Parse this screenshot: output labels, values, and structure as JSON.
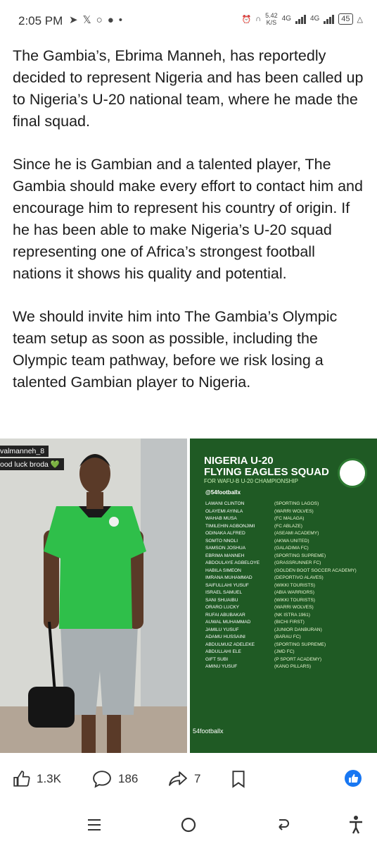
{
  "status": {
    "time": "2:05 PM",
    "speed_value": "5.42",
    "speed_unit": "K/S",
    "network_1": "4G",
    "network_2": "4G",
    "battery": "45"
  },
  "article": {
    "paragraphs": [
      "The Gambia’s, Ebrima Manneh, has reportedly decided to represent Nigeria and has been called up to Nigeria’s U-20 national team, where he made the final squad.",
      "Since he is Gambian and a talented player, The Gambia should make every effort to contact him and encourage him to represent his country of origin. If he has been able to make Nigeria’s U-20 squad representing one of Africa’s strongest football nations it shows his quality and potential.",
      "We should invite him into The Gambia’s Olympic team setup as soon as possible, including the Olympic team pathway, before we risk losing a talented Gambian player to Nigeria."
    ]
  },
  "left_image": {
    "username": "valmanneh_8",
    "caption": "ood luck broda 💚"
  },
  "right_image": {
    "title_line1": "NIGERIA U-20",
    "title_line2": "FLYING EAGLES SQUAD",
    "subtitle": "FOR WAFU-B U-20 CHAMPIONSHIP",
    "watermark_top": "@54footballx",
    "watermark_bottom": "54footballx",
    "roster": [
      {
        "player": "LAWANI CLINTON",
        "club": "(SPORTING LAGOS)"
      },
      {
        "player": "OLAYEMI AYINLA",
        "club": "(WARRI WOLVES)"
      },
      {
        "player": "WAHAB MUSA",
        "club": "(FC MALAGA)"
      },
      {
        "player": "TIMILEHIN AGBONJIMI",
        "club": "(FC ABLAZE)"
      },
      {
        "player": "ODINAKA ALFRED",
        "club": "(ASEAMI ACADEMY)"
      },
      {
        "player": "SOMTO NNOLI",
        "club": "(AKWA UNITED)"
      },
      {
        "player": "SAMSON JOSHUA",
        "club": "(GALADIMA FC)"
      },
      {
        "player": "EBRIMA MANNEH",
        "club": "(SPORTING SUPREME)"
      },
      {
        "player": "ABDOULAYE AGBELOYE",
        "club": "(GRASSRUNNER FC)"
      },
      {
        "player": "HABILA SIMEON",
        "club": "(GOLDEN BOOT SOCCER ACADEMY)"
      },
      {
        "player": "IMRANA MUHAMMAD",
        "club": "(DEPORTIVO ALAVES)"
      },
      {
        "player": "SAIFULLAHI YUSUF",
        "club": "(WIKKI TOURISTS)"
      },
      {
        "player": "ISRAEL SAMUEL",
        "club": "(ABIA WARRIORS)"
      },
      {
        "player": "SANI SHUAIBU",
        "club": "(WIKKI TOURISTS)"
      },
      {
        "player": "ORARO LUCKY",
        "club": "(WARRI WOLVES)"
      },
      {
        "player": "RUFAI ABUBAKAR",
        "club": "(NK ISTRA 1961)"
      },
      {
        "player": "AUWAL MUHAMMAD",
        "club": "(BICHI FIRST)"
      },
      {
        "player": "JAMILU YUSUF",
        "club": "(JUNIOR DANBURAN)"
      },
      {
        "player": "ADAMU HUSSAINI",
        "club": "(BARAU FC)"
      },
      {
        "player": "ABDULMUIZ ADELEKE",
        "club": "(SPORTING SUPREME)"
      },
      {
        "player": "ABDULLAHI ELE",
        "club": "(JMD FC)"
      },
      {
        "player": "GIFT SUBI",
        "club": "(P SPORT ACADEMY)"
      },
      {
        "player": "AMINU YUSUF",
        "club": "(KANO PILLARS)"
      }
    ]
  },
  "actions": {
    "likes": "1.3K",
    "comments": "186",
    "shares": "7"
  },
  "colors": {
    "facebook_blue": "#1877f2",
    "jersey_green": "#2fbf4a",
    "poster_green": "#1f5a24"
  },
  "icons": [
    "like-icon",
    "comment-icon",
    "share-icon",
    "bookmark-icon",
    "facebook-like-icon",
    "recent-apps-icon",
    "home-icon",
    "back-icon",
    "accessibility-icon"
  ]
}
